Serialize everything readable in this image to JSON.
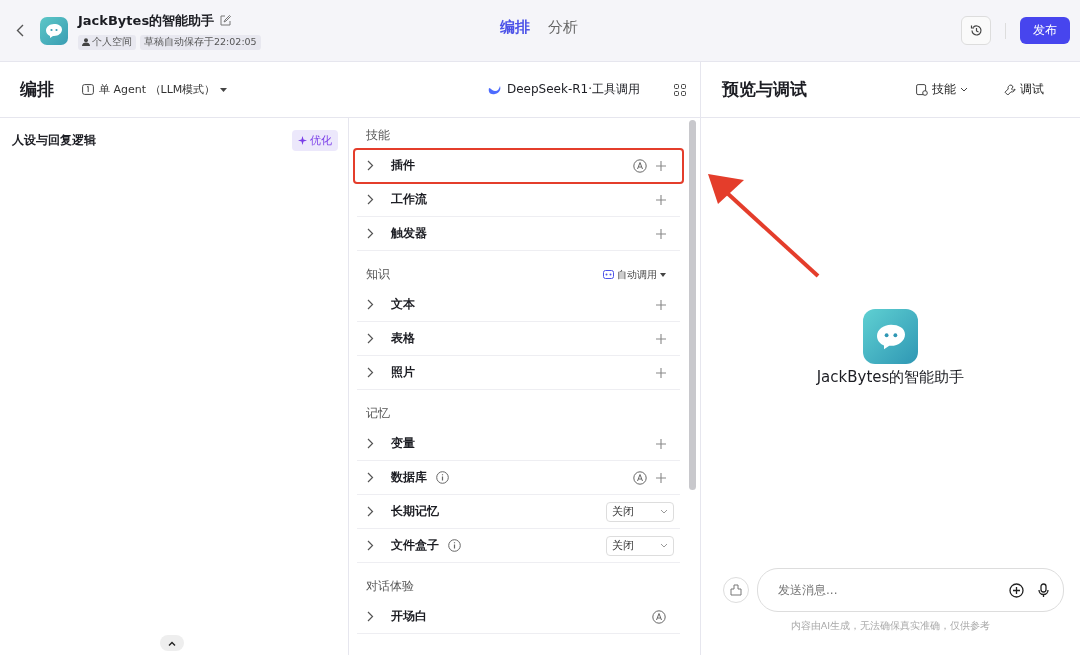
{
  "header": {
    "app_name": "JackBytes的智能助手",
    "tags": [
      {
        "kind": "space",
        "label": "个人空间"
      },
      {
        "kind": "plain",
        "label": "草稿自动保存于22:02:05"
      }
    ],
    "tabs": [
      {
        "label": "编排",
        "selected": true
      },
      {
        "label": "分析",
        "selected": false
      }
    ],
    "publish_button": "发布"
  },
  "editor": {
    "title": "编排",
    "mode": "单 Agent （LLM模式）",
    "model": "DeepSeek-R1·工具调用"
  },
  "persona": {
    "title": "人设与回复逻辑",
    "optimize_button": "优化"
  },
  "sections": [
    {
      "title": "技能",
      "items": [
        {
          "label": "插件",
          "info": false,
          "auto": true,
          "add": true,
          "highlighted": true
        },
        {
          "label": "工作流",
          "info": false,
          "auto": false,
          "add": true,
          "highlighted": false
        },
        {
          "label": "触发器",
          "info": false,
          "auto": false,
          "add": true,
          "highlighted": false
        }
      ]
    },
    {
      "title": "知识",
      "action": "自动调用",
      "items": [
        {
          "label": "文本",
          "info": false,
          "auto": false,
          "add": true,
          "highlighted": false
        },
        {
          "label": "表格",
          "info": false,
          "auto": false,
          "add": true,
          "highlighted": false
        },
        {
          "label": "照片",
          "info": false,
          "auto": false,
          "add": true,
          "highlighted": false
        }
      ]
    },
    {
      "title": "记忆",
      "items": [
        {
          "label": "变量",
          "info": false,
          "auto": false,
          "add": true,
          "highlighted": false
        },
        {
          "label": "数据库",
          "info": true,
          "auto": true,
          "add": true,
          "highlighted": false
        },
        {
          "label": "长期记忆",
          "info": false,
          "auto": false,
          "add": false,
          "select": "关闭",
          "highlighted": false
        },
        {
          "label": "文件盒子",
          "info": true,
          "auto": false,
          "add": false,
          "select": "关闭",
          "highlighted": false
        }
      ]
    },
    {
      "title": "对话体验",
      "items": [
        {
          "label": "开场白",
          "info": false,
          "auto": true,
          "add": false,
          "highlighted": false
        }
      ]
    }
  ],
  "preview": {
    "title": "预览与调试",
    "skills_button": "技能",
    "debug_button": "调试",
    "bot_name": "JackBytes的智能助手",
    "input": {
      "placeholder": "发送消息..."
    },
    "disclaimer": "内容由AI生成，无法确保真实准确，仅供参考"
  }
}
